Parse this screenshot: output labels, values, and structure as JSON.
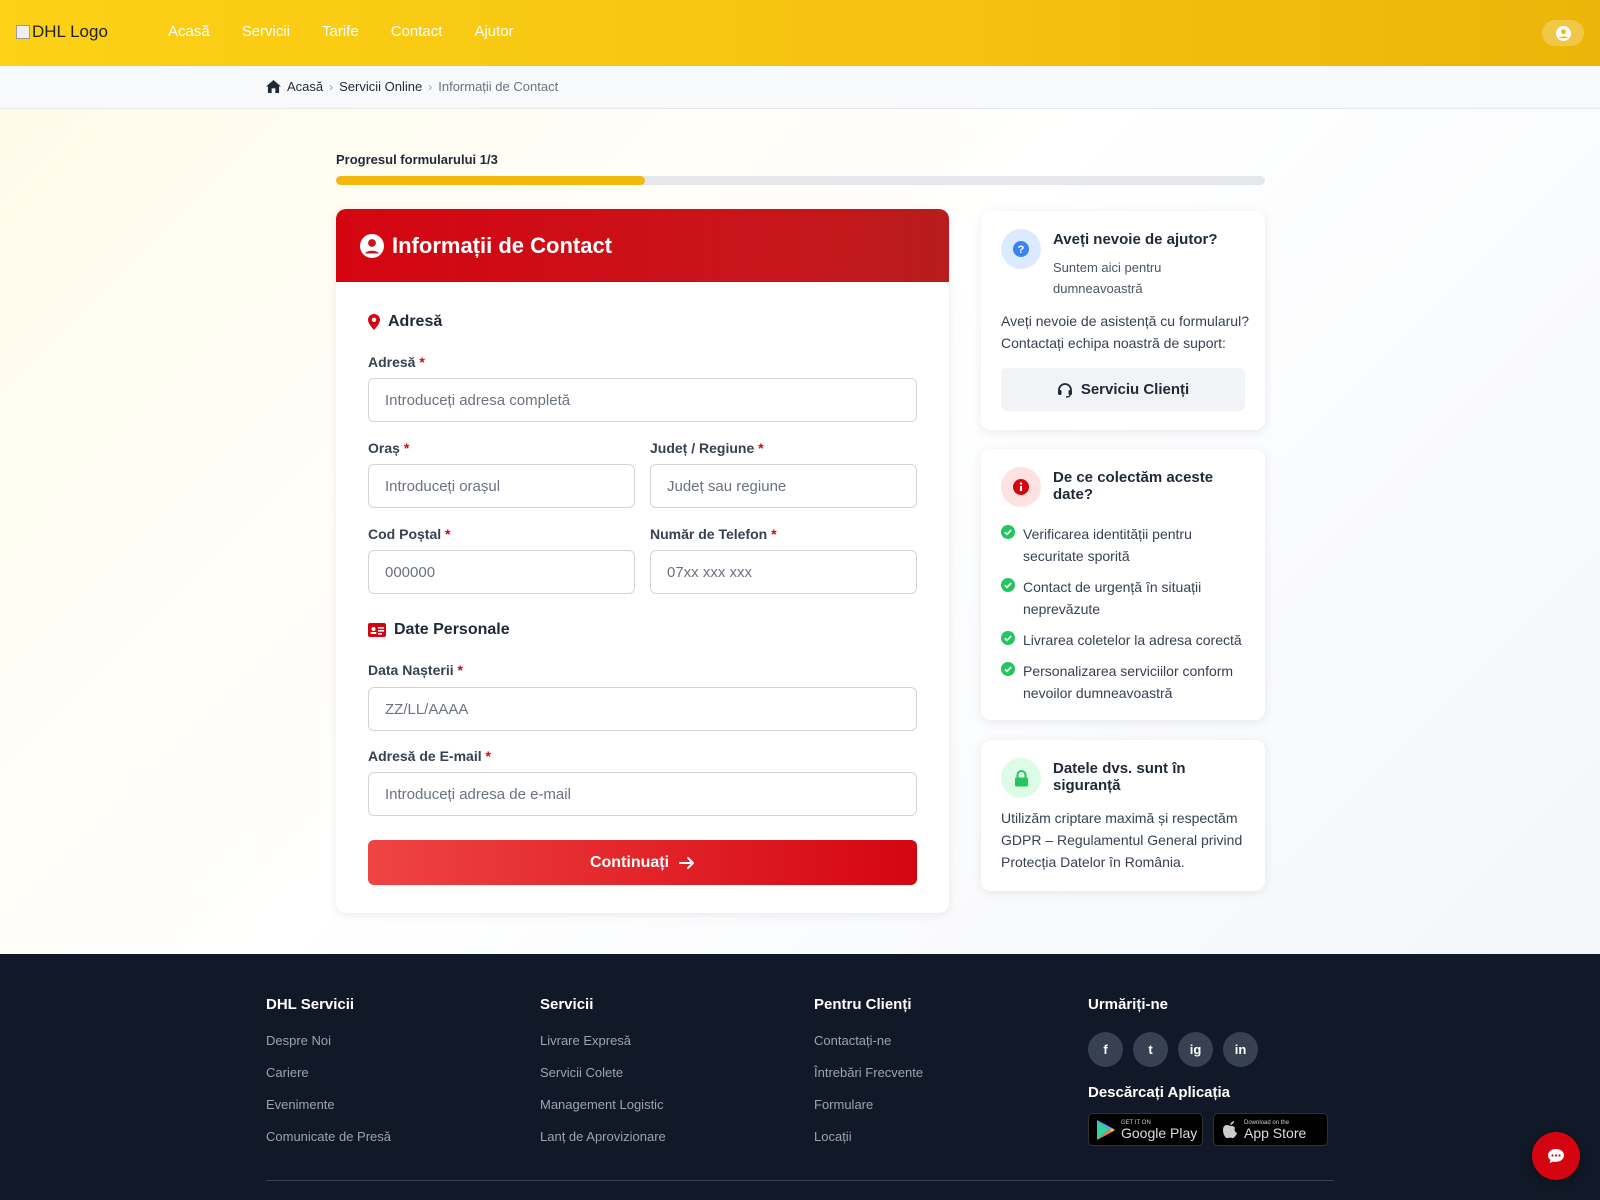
{
  "header": {
    "logo_alt": "DHL Logo",
    "nav": [
      "Acasă",
      "Servicii",
      "Tarife",
      "Contact",
      "Ajutor"
    ]
  },
  "breadcrumb": {
    "home": "Acasă",
    "section": "Servicii Online",
    "current": "Informații de Contact"
  },
  "progress": {
    "label": "Progresul formularului 1/3",
    "fraction": 0.333,
    "color": "#f0b90b"
  },
  "form": {
    "title": "Informații de Contact",
    "address_section": "Adresă",
    "personal_section": "Date Personale",
    "required_mark": "*",
    "fields": {
      "address": {
        "label": "Adresă",
        "placeholder": "Introduceți adresa completă"
      },
      "city": {
        "label": "Oraș",
        "placeholder": "Introduceți orașul"
      },
      "county": {
        "label": "Județ / Regiune",
        "placeholder": "Județ sau regiune"
      },
      "postal": {
        "label": "Cod Poștal",
        "placeholder": "000000"
      },
      "phone": {
        "label": "Număr de Telefon",
        "placeholder": "07xx xxx xxx"
      },
      "birthdate": {
        "label": "Data Nașterii",
        "placeholder": "ZZ/LL/AAAA"
      },
      "email": {
        "label": "Adresă de E-mail",
        "placeholder": "Introduceți adresa de e-mail"
      }
    },
    "submit_label": "Continuați"
  },
  "help_card": {
    "title": "Aveți nevoie de ajutor?",
    "subtitle": "Suntem aici pentru dumneavoastră",
    "body": "Aveți nevoie de asistență cu formularul? Contactați echipa noastră de suport:",
    "button": "Serviciu Clienți"
  },
  "why_card": {
    "title": "De ce colectăm aceste date?",
    "reasons": [
      "Verificarea identității pentru securitate sporită",
      "Contact de urgență în situații neprevăzute",
      "Livrarea coletelor la adresa corectă",
      "Personalizarea serviciilor conform nevoilor dumneavoastră"
    ]
  },
  "security_card": {
    "title": "Datele dvs. sunt în siguranță",
    "body": "Utilizăm criptare maximă și respectăm GDPR – Regulamentul General privind Protecția Datelor în România."
  },
  "footer": {
    "columns": [
      {
        "title": "DHL Servicii",
        "links": [
          "Despre Noi",
          "Cariere",
          "Evenimente",
          "Comunicate de Presă"
        ]
      },
      {
        "title": "Servicii",
        "links": [
          "Livrare Expresă",
          "Servicii Colete",
          "Management Logistic",
          "Lanț de Aprovizionare"
        ]
      },
      {
        "title": "Pentru Clienți",
        "links": [
          "Contactați-ne",
          "Întrebări Frecvente",
          "Formulare",
          "Locații"
        ]
      }
    ],
    "follow_title": "Urmăriți-ne",
    "social": [
      "f",
      "t",
      "ig",
      "in"
    ],
    "app_title": "Descărcați Aplicația",
    "google_small": "GET IT ON",
    "google_big": "Google Play",
    "apple_small": "Download on the",
    "apple_big": "App Store"
  },
  "colors": {
    "brand_yellow": "#fcd116",
    "brand_red": "#d40511",
    "footer_bg": "#111827"
  }
}
